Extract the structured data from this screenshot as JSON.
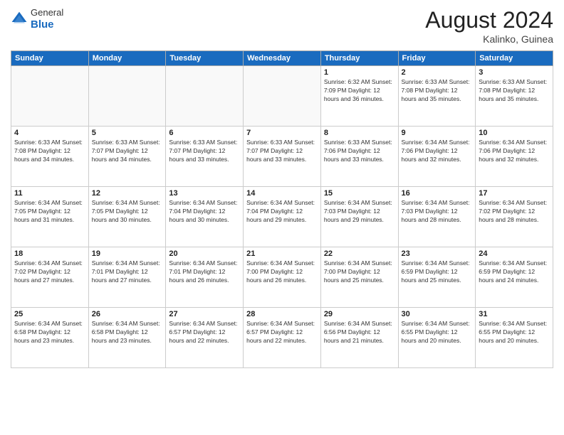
{
  "header": {
    "logo_general": "General",
    "logo_blue": "Blue",
    "title": "August 2024",
    "subtitle": "Kalinko, Guinea"
  },
  "days_of_week": [
    "Sunday",
    "Monday",
    "Tuesday",
    "Wednesday",
    "Thursday",
    "Friday",
    "Saturday"
  ],
  "weeks": [
    [
      {
        "day": "",
        "info": ""
      },
      {
        "day": "",
        "info": ""
      },
      {
        "day": "",
        "info": ""
      },
      {
        "day": "",
        "info": ""
      },
      {
        "day": "1",
        "info": "Sunrise: 6:32 AM\nSunset: 7:09 PM\nDaylight: 12 hours\nand 36 minutes."
      },
      {
        "day": "2",
        "info": "Sunrise: 6:33 AM\nSunset: 7:08 PM\nDaylight: 12 hours\nand 35 minutes."
      },
      {
        "day": "3",
        "info": "Sunrise: 6:33 AM\nSunset: 7:08 PM\nDaylight: 12 hours\nand 35 minutes."
      }
    ],
    [
      {
        "day": "4",
        "info": "Sunrise: 6:33 AM\nSunset: 7:08 PM\nDaylight: 12 hours\nand 34 minutes."
      },
      {
        "day": "5",
        "info": "Sunrise: 6:33 AM\nSunset: 7:07 PM\nDaylight: 12 hours\nand 34 minutes."
      },
      {
        "day": "6",
        "info": "Sunrise: 6:33 AM\nSunset: 7:07 PM\nDaylight: 12 hours\nand 33 minutes."
      },
      {
        "day": "7",
        "info": "Sunrise: 6:33 AM\nSunset: 7:07 PM\nDaylight: 12 hours\nand 33 minutes."
      },
      {
        "day": "8",
        "info": "Sunrise: 6:33 AM\nSunset: 7:06 PM\nDaylight: 12 hours\nand 33 minutes."
      },
      {
        "day": "9",
        "info": "Sunrise: 6:34 AM\nSunset: 7:06 PM\nDaylight: 12 hours\nand 32 minutes."
      },
      {
        "day": "10",
        "info": "Sunrise: 6:34 AM\nSunset: 7:06 PM\nDaylight: 12 hours\nand 32 minutes."
      }
    ],
    [
      {
        "day": "11",
        "info": "Sunrise: 6:34 AM\nSunset: 7:05 PM\nDaylight: 12 hours\nand 31 minutes."
      },
      {
        "day": "12",
        "info": "Sunrise: 6:34 AM\nSunset: 7:05 PM\nDaylight: 12 hours\nand 30 minutes."
      },
      {
        "day": "13",
        "info": "Sunrise: 6:34 AM\nSunset: 7:04 PM\nDaylight: 12 hours\nand 30 minutes."
      },
      {
        "day": "14",
        "info": "Sunrise: 6:34 AM\nSunset: 7:04 PM\nDaylight: 12 hours\nand 29 minutes."
      },
      {
        "day": "15",
        "info": "Sunrise: 6:34 AM\nSunset: 7:03 PM\nDaylight: 12 hours\nand 29 minutes."
      },
      {
        "day": "16",
        "info": "Sunrise: 6:34 AM\nSunset: 7:03 PM\nDaylight: 12 hours\nand 28 minutes."
      },
      {
        "day": "17",
        "info": "Sunrise: 6:34 AM\nSunset: 7:02 PM\nDaylight: 12 hours\nand 28 minutes."
      }
    ],
    [
      {
        "day": "18",
        "info": "Sunrise: 6:34 AM\nSunset: 7:02 PM\nDaylight: 12 hours\nand 27 minutes."
      },
      {
        "day": "19",
        "info": "Sunrise: 6:34 AM\nSunset: 7:01 PM\nDaylight: 12 hours\nand 27 minutes."
      },
      {
        "day": "20",
        "info": "Sunrise: 6:34 AM\nSunset: 7:01 PM\nDaylight: 12 hours\nand 26 minutes."
      },
      {
        "day": "21",
        "info": "Sunrise: 6:34 AM\nSunset: 7:00 PM\nDaylight: 12 hours\nand 26 minutes."
      },
      {
        "day": "22",
        "info": "Sunrise: 6:34 AM\nSunset: 7:00 PM\nDaylight: 12 hours\nand 25 minutes."
      },
      {
        "day": "23",
        "info": "Sunrise: 6:34 AM\nSunset: 6:59 PM\nDaylight: 12 hours\nand 25 minutes."
      },
      {
        "day": "24",
        "info": "Sunrise: 6:34 AM\nSunset: 6:59 PM\nDaylight: 12 hours\nand 24 minutes."
      }
    ],
    [
      {
        "day": "25",
        "info": "Sunrise: 6:34 AM\nSunset: 6:58 PM\nDaylight: 12 hours\nand 23 minutes."
      },
      {
        "day": "26",
        "info": "Sunrise: 6:34 AM\nSunset: 6:58 PM\nDaylight: 12 hours\nand 23 minutes."
      },
      {
        "day": "27",
        "info": "Sunrise: 6:34 AM\nSunset: 6:57 PM\nDaylight: 12 hours\nand 22 minutes."
      },
      {
        "day": "28",
        "info": "Sunrise: 6:34 AM\nSunset: 6:57 PM\nDaylight: 12 hours\nand 22 minutes."
      },
      {
        "day": "29",
        "info": "Sunrise: 6:34 AM\nSunset: 6:56 PM\nDaylight: 12 hours\nand 21 minutes."
      },
      {
        "day": "30",
        "info": "Sunrise: 6:34 AM\nSunset: 6:55 PM\nDaylight: 12 hours\nand 20 minutes."
      },
      {
        "day": "31",
        "info": "Sunrise: 6:34 AM\nSunset: 6:55 PM\nDaylight: 12 hours\nand 20 minutes."
      }
    ]
  ]
}
